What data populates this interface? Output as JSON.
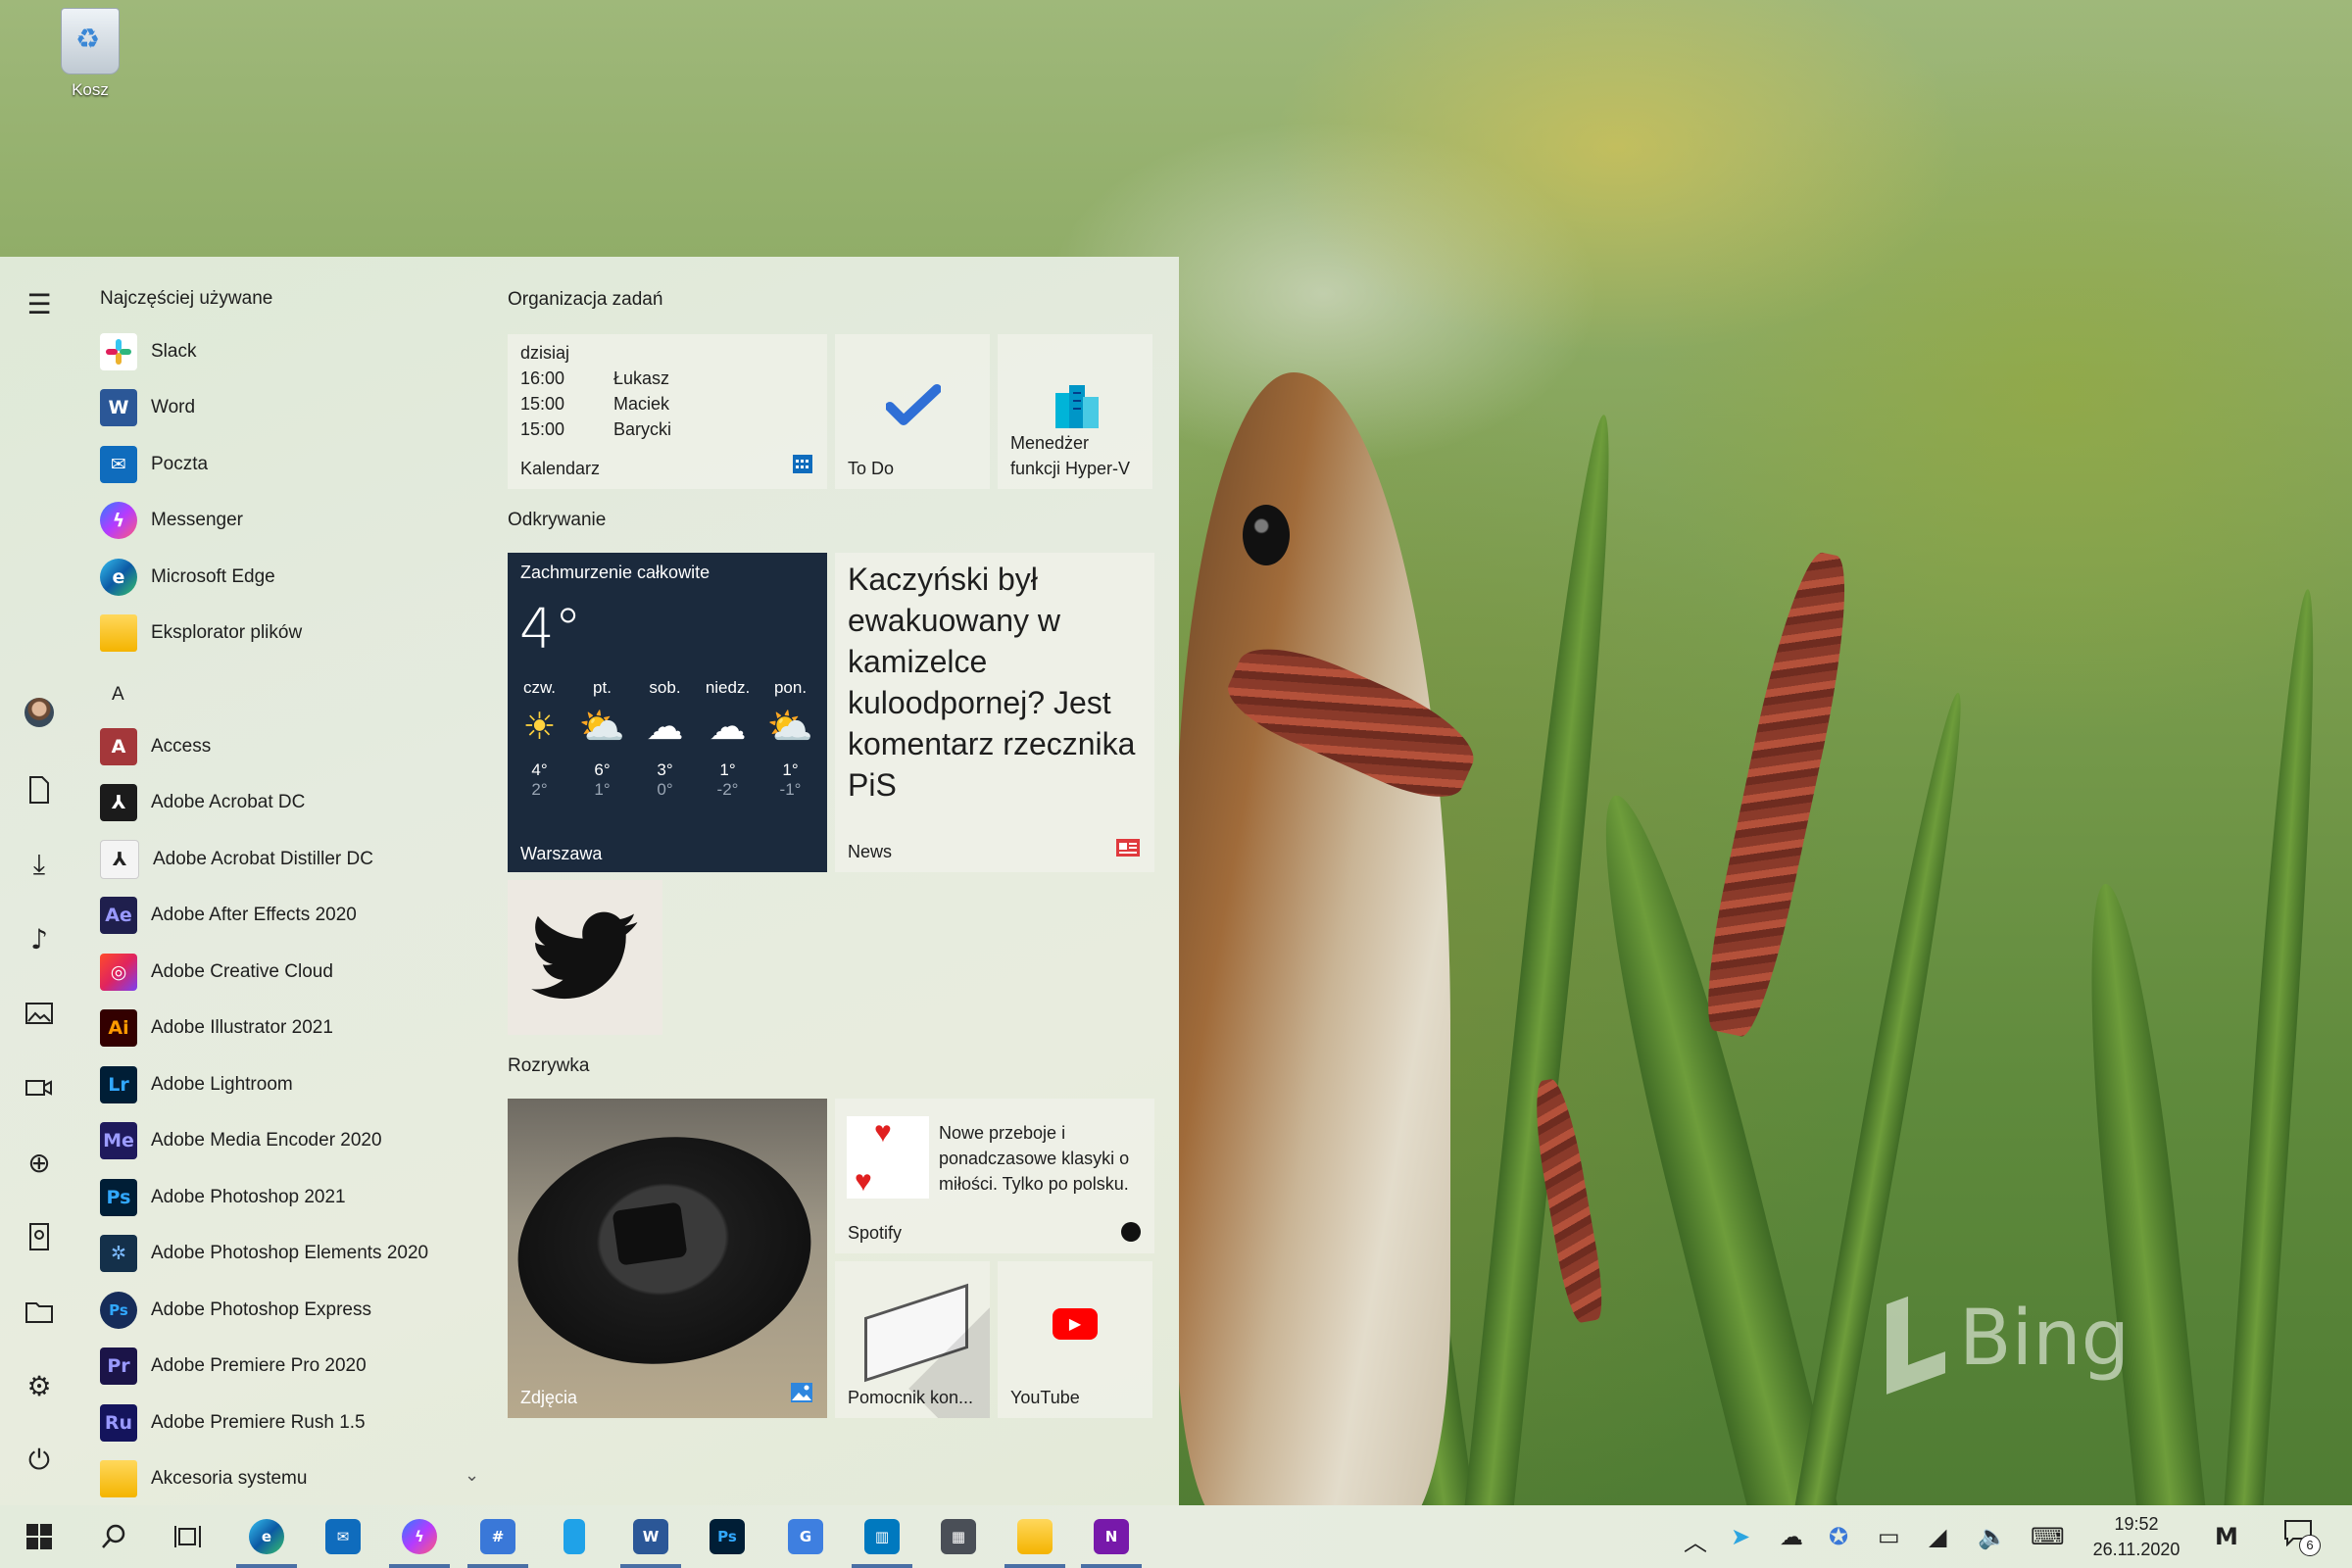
{
  "desktop": {
    "recycle_bin_label": "Kosz",
    "bing_logo": "Bing"
  },
  "start_menu": {
    "most_used_header": "Najczęściej używane",
    "most_used": [
      {
        "label": "Slack",
        "icon": "slack-icon",
        "color": "#ffffff"
      },
      {
        "label": "Word",
        "icon": "word-icon",
        "color": "#2b5797"
      },
      {
        "label": "Poczta",
        "icon": "mail-icon",
        "color": "#0f6cbd"
      },
      {
        "label": "Messenger",
        "icon": "messenger-icon",
        "color": "#8b5cf6"
      },
      {
        "label": "Microsoft Edge",
        "icon": "edge-icon",
        "color": "#1a8ad4"
      },
      {
        "label": "Eksplorator plików",
        "icon": "folder-icon",
        "color": "#f4c430"
      }
    ],
    "letter_a": "A",
    "apps": [
      {
        "label": "Access",
        "icon": "access-icon",
        "abbr": "A",
        "color": "#a4373a"
      },
      {
        "label": "Adobe Acrobat DC",
        "icon": "acrobat-icon",
        "abbr": "⅄",
        "color": "#1b1b1b"
      },
      {
        "label": "Adobe Acrobat Distiller DC",
        "icon": "acrobat-distiller-icon",
        "abbr": "⅄",
        "color": "#f0f0f0"
      },
      {
        "label": "Adobe After Effects 2020",
        "icon": "after-effects-icon",
        "abbr": "Ae",
        "color": "#1f1f4d"
      },
      {
        "label": "Adobe Creative Cloud",
        "icon": "creative-cloud-icon",
        "abbr": "◎",
        "color": "#e0245e"
      },
      {
        "label": "Adobe Illustrator 2021",
        "icon": "illustrator-icon",
        "abbr": "Ai",
        "color": "#330000"
      },
      {
        "label": "Adobe Lightroom",
        "icon": "lightroom-icon",
        "abbr": "Lr",
        "color": "#001e36"
      },
      {
        "label": "Adobe Media Encoder 2020",
        "icon": "media-encoder-icon",
        "abbr": "Me",
        "color": "#1f1a5c"
      },
      {
        "label": "Adobe Photoshop 2021",
        "icon": "photoshop-icon",
        "abbr": "Ps",
        "color": "#001e36"
      },
      {
        "label": "Adobe Photoshop Elements 2020",
        "icon": "photoshop-elements-icon",
        "abbr": "✲",
        "color": "#14304a"
      },
      {
        "label": "Adobe Photoshop Express",
        "icon": "photoshop-express-icon",
        "abbr": "Ps",
        "color": "#162c59"
      },
      {
        "label": "Adobe Premiere Pro 2020",
        "icon": "premiere-pro-icon",
        "abbr": "Pr",
        "color": "#1b1448"
      },
      {
        "label": "Adobe Premiere Rush 1.5",
        "icon": "premiere-rush-icon",
        "abbr": "Ru",
        "color": "#14145c"
      },
      {
        "label": "Akcesoria systemu",
        "icon": "folder-icon",
        "abbr": "",
        "color": "#f4c430"
      }
    ]
  },
  "tiles": {
    "group1_header": "Organizacja zadań",
    "calendar": {
      "today_label": "dzisiaj",
      "events": [
        {
          "time": "16:00",
          "name": "Łukasz"
        },
        {
          "time": "15:00",
          "name": "Maciek"
        },
        {
          "time": "15:00",
          "name": "Barycki"
        }
      ],
      "label": "Kalendarz"
    },
    "todo_label": "To Do",
    "hyperv_label_1": "Menedżer",
    "hyperv_label_2": "funkcji Hyper-V",
    "group2_header": "Odkrywanie",
    "weather": {
      "condition": "Zachmurzenie całkowite",
      "temp": "4°",
      "days": [
        {
          "name": "czw.",
          "icon": "sun-icon",
          "hi": "4°",
          "lo": "2°"
        },
        {
          "name": "pt.",
          "icon": "partly-cloudy-icon",
          "hi": "6°",
          "lo": "1°"
        },
        {
          "name": "sob.",
          "icon": "snow-cloud-icon",
          "hi": "3°",
          "lo": "0°"
        },
        {
          "name": "niedz.",
          "icon": "cloud-icon",
          "hi": "1°",
          "lo": "-2°"
        },
        {
          "name": "pon.",
          "icon": "partly-cloudy-icon",
          "hi": "1°",
          "lo": "-1°"
        }
      ],
      "city": "Warszawa"
    },
    "news": {
      "headline": "Kaczyński był ewakuowany w kamizelce kuloodpornej? Jest komentarz rzecznika PiS",
      "label": "News"
    },
    "group3_header": "Rozrywka",
    "photos_label": "Zdjęcia",
    "spotify": {
      "text": "Nowe przeboje i ponadczasowe klasyki o miłości. Tylko po polsku.",
      "label": "Spotify"
    },
    "assistant_label": "Pomocnik kon...",
    "youtube_label": "YouTube"
  },
  "taskbar": {
    "time": "19:52",
    "date": "26.11.2020",
    "notification_count": "6"
  }
}
